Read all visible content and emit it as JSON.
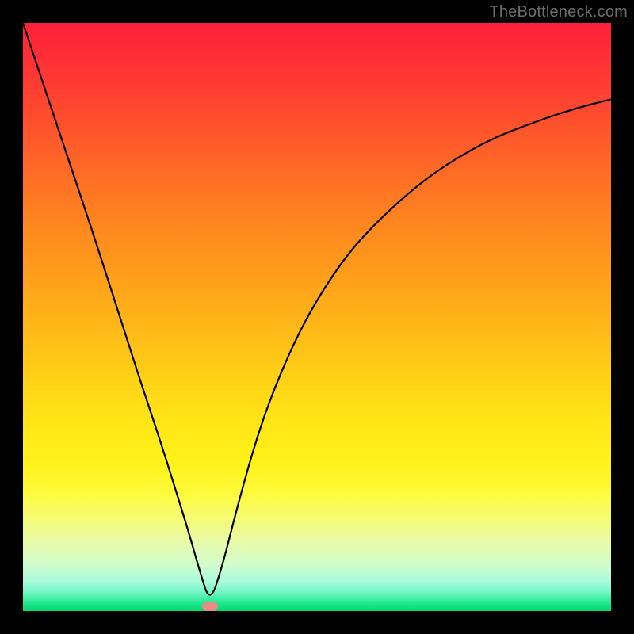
{
  "watermark": "TheBottleneck.com",
  "colors": {
    "curve_stroke": "#000000",
    "marker_fill": "#e98d84",
    "frame": "#000000"
  },
  "marker": {
    "x_frac": 0.318,
    "y_frac": 0.992
  },
  "chart_data": {
    "type": "line",
    "title": "",
    "xlabel": "",
    "ylabel": "",
    "xlim": [
      0,
      1
    ],
    "ylim": [
      0,
      1
    ],
    "grid": false,
    "legend": false,
    "annotations": [
      "TheBottleneck.com"
    ],
    "series": [
      {
        "name": "bottleneck-curve",
        "x": [
          0.0,
          0.04,
          0.08,
          0.12,
          0.16,
          0.2,
          0.23,
          0.26,
          0.28,
          0.3,
          0.318,
          0.34,
          0.36,
          0.39,
          0.42,
          0.46,
          0.5,
          0.55,
          0.6,
          0.66,
          0.72,
          0.8,
          0.88,
          0.94,
          1.0
        ],
        "y": [
          1.0,
          0.88,
          0.76,
          0.64,
          0.515,
          0.39,
          0.3,
          0.205,
          0.14,
          0.07,
          0.012,
          0.08,
          0.16,
          0.27,
          0.36,
          0.455,
          0.53,
          0.605,
          0.66,
          0.715,
          0.76,
          0.805,
          0.835,
          0.855,
          0.87
        ]
      }
    ],
    "marker_point": {
      "x": 0.318,
      "y": 0.008
    },
    "background_gradient": {
      "top": "#ff1f3a",
      "mid": "#ffe616",
      "bottom": "#00d976"
    }
  }
}
